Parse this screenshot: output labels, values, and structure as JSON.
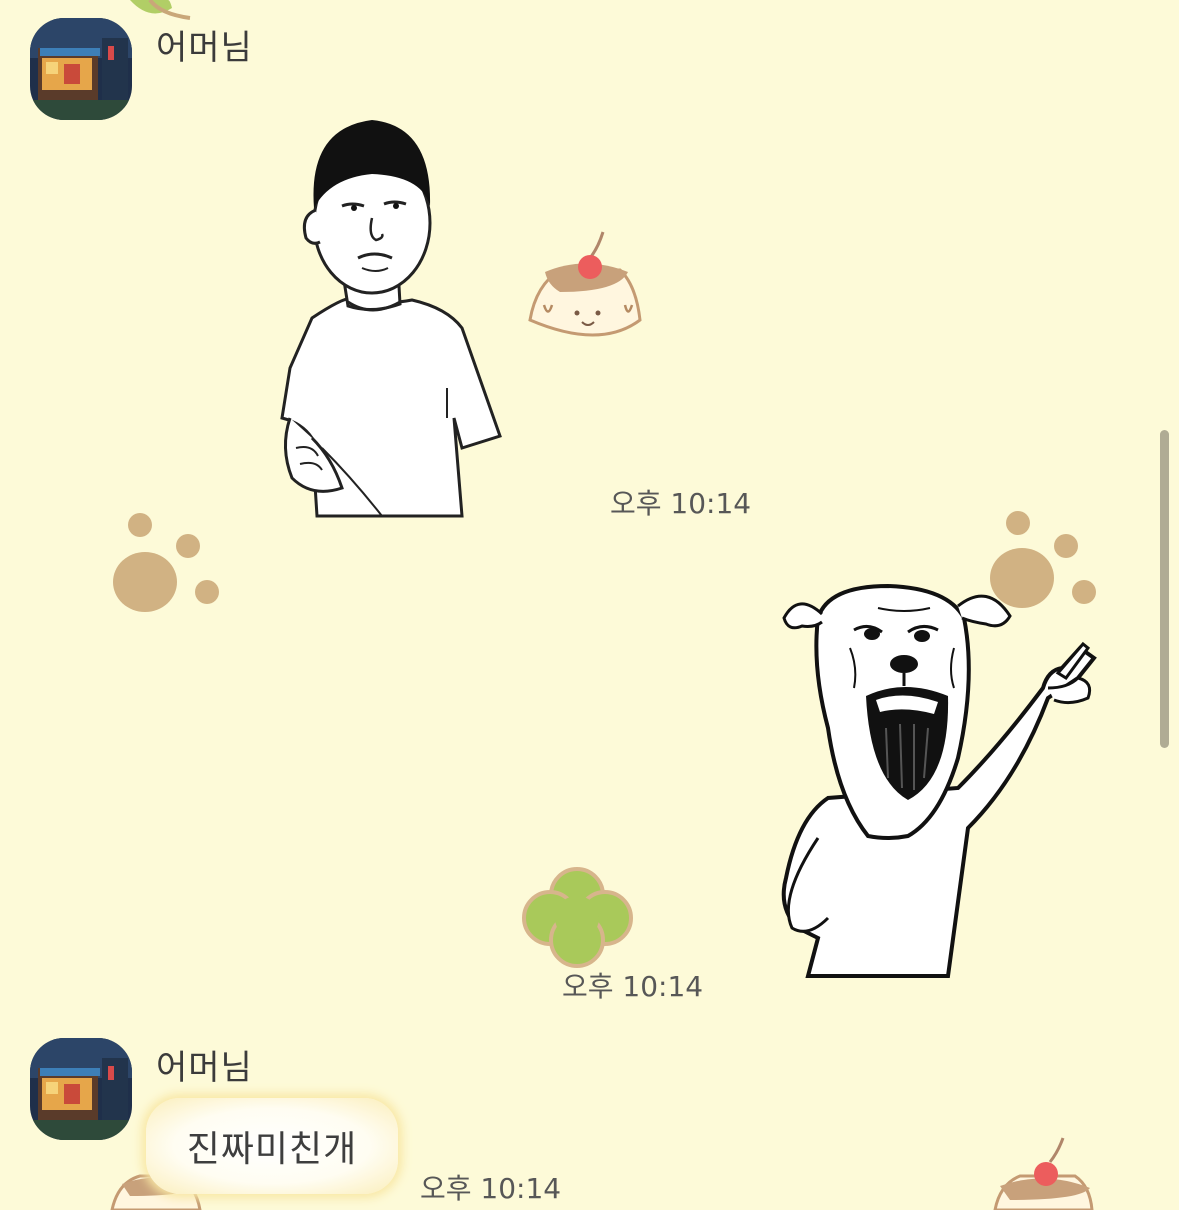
{
  "messages": [
    {
      "sender": "어머님",
      "type": "sticker",
      "sticker": "man-lifting-shirt-sticker",
      "time": "오후 10:14"
    },
    {
      "sender": "",
      "type": "sticker",
      "sticker": "screaming-dog-pointing-sticker",
      "time": "오후 10:14"
    },
    {
      "sender": "어머님",
      "type": "text",
      "text": "진짜미친개",
      "time": "오후 10:14"
    }
  ],
  "wallpaper": {
    "background": "#fdfad8",
    "motifs": [
      "paw-print-icon",
      "pudding-icon",
      "clover-icon"
    ]
  },
  "colors": {
    "bubble_glow": "#f8e7a4",
    "scrollbar": "#b0ac94"
  }
}
